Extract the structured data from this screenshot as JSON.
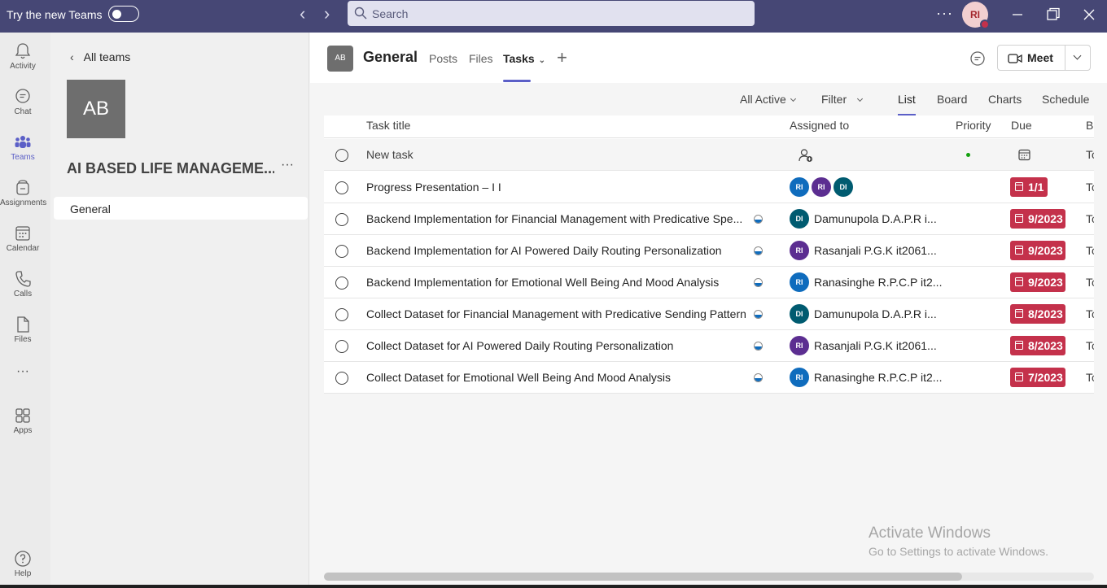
{
  "titlebar": {
    "try_label": "Try the new Teams",
    "search_placeholder": "Search",
    "more_label": "···",
    "avatar_initials": "RI"
  },
  "rail": {
    "items": [
      {
        "label": "Activity",
        "icon": "bell-icon"
      },
      {
        "label": "Chat",
        "icon": "chat-icon"
      },
      {
        "label": "Teams",
        "icon": "teams-icon",
        "active": true
      },
      {
        "label": "Assignments",
        "icon": "assignments-icon"
      },
      {
        "label": "Calendar",
        "icon": "calendar-icon"
      },
      {
        "label": "Calls",
        "icon": "phone-icon"
      },
      {
        "label": "Files",
        "icon": "file-icon"
      },
      {
        "label": "···",
        "icon": "more-icon"
      },
      {
        "label": "Apps",
        "icon": "apps-icon"
      },
      {
        "label": "Help",
        "icon": "help-icon"
      }
    ]
  },
  "teampane": {
    "back_label": "All teams",
    "team_initials": "AB",
    "team_name": "AI BASED LIFE MANAGEME...",
    "more_label": "···",
    "channel": "General"
  },
  "channel_header": {
    "tile": "AB",
    "title": "General",
    "tabs": [
      "Posts",
      "Files",
      "Tasks"
    ],
    "active_tab": "Tasks",
    "add_label": "+",
    "meet_label": "Meet"
  },
  "toolbar": {
    "filter_active": "All Active",
    "filter": "Filter",
    "views": [
      "List",
      "Board",
      "Charts",
      "Schedule"
    ],
    "active_view": "List"
  },
  "grid": {
    "headers": [
      "Task title",
      "Assigned to",
      "Priority",
      "Due",
      "B"
    ],
    "new_task_label": "New task",
    "rows": [
      {
        "title": "Progress Presentation – I I",
        "assignees": [
          "RI",
          "RI",
          "DI"
        ],
        "assignee_name": "",
        "due": "1/1",
        "bucket": "To",
        "progress": false
      },
      {
        "title": "Backend Implementation for Financial Management with Predicative Spe...",
        "assignees": [
          "DI"
        ],
        "assignee_name": "Damunupola D.A.P.R i...",
        "due": "9/2023",
        "bucket": "To",
        "progress": true
      },
      {
        "title": "Backend Implementation for AI Powered Daily Routing Personalization",
        "assignees": [
          "RI"
        ],
        "assignee_name": "Rasanjali P.G.K it2061...",
        "due": "9/2023",
        "bucket": "To",
        "progress": true
      },
      {
        "title": "Backend Implementation for Emotional Well Being And Mood Analysis",
        "assignees": [
          "RI"
        ],
        "assignee_name": "Ranasinghe R.P.C.P it2...",
        "due": "9/2023",
        "bucket": "To",
        "progress": true
      },
      {
        "title": "Collect Dataset for Financial Management with Predicative Sending Pattern",
        "assignees": [
          "DI"
        ],
        "assignee_name": "Damunupola D.A.P.R i...",
        "due": "8/2023",
        "bucket": "To",
        "progress": true
      },
      {
        "title": "Collect Dataset for AI Powered Daily Routing Personalization",
        "assignees": [
          "RI"
        ],
        "assignee_name": "Rasanjali P.G.K it2061...",
        "due": "8/2023",
        "bucket": "To",
        "progress": true
      },
      {
        "title": "Collect Dataset for Emotional Well Being And Mood Analysis",
        "assignees": [
          "RI"
        ],
        "assignee_name": "Ranasinghe R.P.C.P it2...",
        "due": "7/2023",
        "bucket": "To",
        "progress": true
      }
    ]
  },
  "watermark": {
    "line1": "Activate Windows",
    "line2": "Go to Settings to activate Windows."
  },
  "colors": {
    "titlebar": "#464775",
    "accent": "#5b5fc7",
    "due_late": "#c4314b"
  }
}
